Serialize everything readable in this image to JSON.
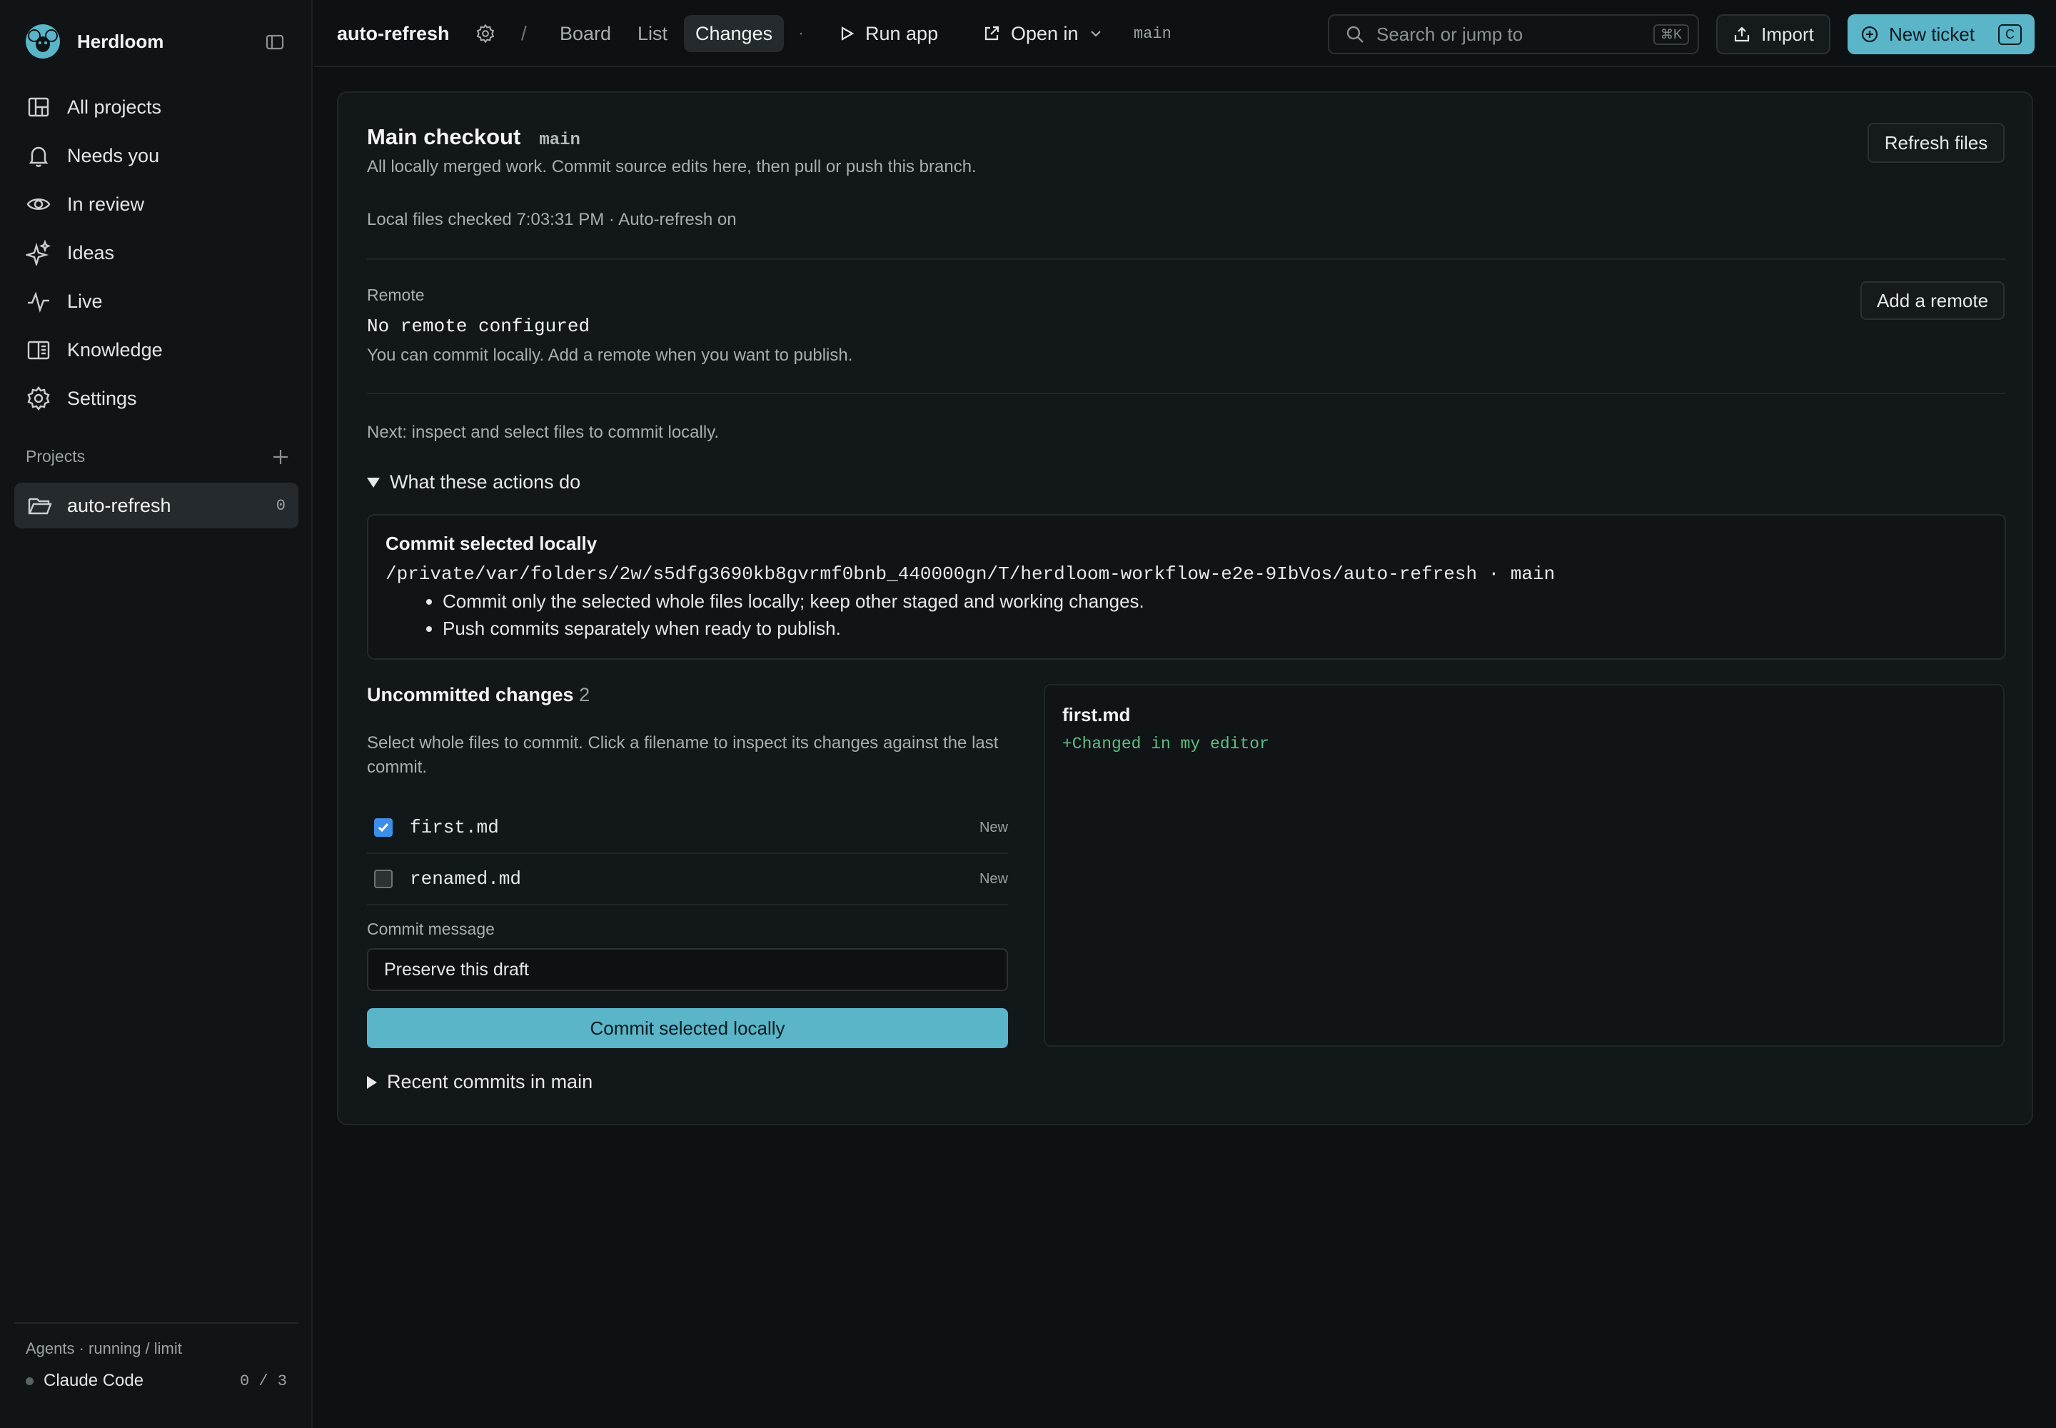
{
  "app": {
    "name": "Herdloom"
  },
  "sidebar": {
    "nav": [
      {
        "label": "All projects",
        "icon": "grid-icon"
      },
      {
        "label": "Needs you",
        "icon": "bell-icon"
      },
      {
        "label": "In review",
        "icon": "eye-icon"
      },
      {
        "label": "Ideas",
        "icon": "sparkle-icon"
      },
      {
        "label": "Live",
        "icon": "pulse-icon"
      },
      {
        "label": "Knowledge",
        "icon": "book-icon"
      },
      {
        "label": "Settings",
        "icon": "gear-icon"
      }
    ],
    "projects_label": "Projects",
    "projects": [
      {
        "name": "auto-refresh",
        "count": "0"
      }
    ],
    "agents": {
      "title": "Agents · running / limit",
      "items": [
        {
          "name": "Claude Code",
          "count": "0 / 3"
        }
      ]
    }
  },
  "topbar": {
    "project": "auto-refresh",
    "slash": "/",
    "tabs": [
      "Board",
      "List",
      "Changes"
    ],
    "active_tab": "Changes",
    "dot": "·",
    "run_app": "Run app",
    "open_in": "Open in",
    "branch": "main",
    "search_placeholder": "Search or jump to",
    "search_shortcut": "⌘K",
    "import": "Import",
    "new_ticket": "New ticket",
    "new_ticket_shortcut": "C"
  },
  "main": {
    "title": "Main checkout",
    "branch": "main",
    "subtitle": "All locally merged work. Commit source edits here, then pull or push this branch.",
    "refresh_button": "Refresh files",
    "checked_status": "Local files checked 7:03:31 PM · Auto-refresh on",
    "remote": {
      "label": "Remote",
      "value": "No remote configured",
      "help": "You can commit locally. Add a remote when you want to publish.",
      "button": "Add a remote"
    },
    "next_step": "Next: inspect and select files to commit locally.",
    "details_summary": "What these actions do",
    "info": {
      "title": "Commit selected locally",
      "path": "/private/var/folders/2w/s5dfg3690kb8gvrmf0bnb_440000gn/T/herdloom-workflow-e2e-9IbVos/auto-refresh · main",
      "bullets": [
        "Commit only the selected whole files locally; keep other staged and working changes.",
        "Push commits separately when ready to publish."
      ]
    },
    "uncommitted": {
      "title": "Uncommitted changes",
      "count": "2",
      "help": "Select whole files to commit. Click a filename to inspect its changes against the last commit.",
      "files": [
        {
          "name": "first.md",
          "status": "New",
          "checked": true
        },
        {
          "name": "renamed.md",
          "status": "New",
          "checked": false
        }
      ],
      "commit_message_label": "Commit message",
      "commit_message_value": "Preserve this draft",
      "commit_button": "Commit selected locally",
      "recent_summary": "Recent commits in main"
    },
    "diff": {
      "file": "first.md",
      "line": "+Changed in my editor"
    }
  },
  "colors": {
    "accent": "#5ab5c8",
    "checkbox": "#3d8ee8",
    "diff_add": "#5fbf82",
    "background": "#0d1113"
  }
}
